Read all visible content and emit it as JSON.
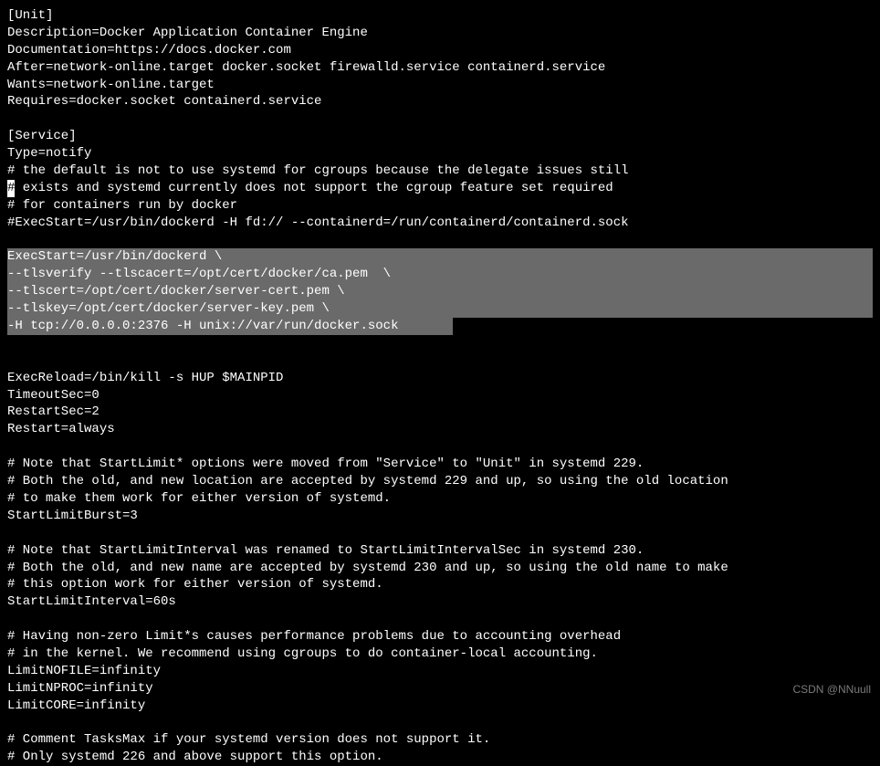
{
  "lines": {
    "l1": "[Unit]",
    "l2": "Description=Docker Application Container Engine",
    "l3": "Documentation=https://docs.docker.com",
    "l4": "After=network-online.target docker.socket firewalld.service containerd.service",
    "l5": "Wants=network-online.target",
    "l6": "Requires=docker.socket containerd.service",
    "l7": "",
    "l8": "[Service]",
    "l9": "Type=notify",
    "l10": "# the default is not to use systemd for cgroups because the delegate issues still",
    "l11a": "#",
    "l11b": " exists and systemd currently does not support the cgroup feature set required",
    "l12": "# for containers run by docker",
    "l13": "#ExecStart=/usr/bin/dockerd -H fd:// --containerd=/run/containerd/containerd.sock",
    "l14": "",
    "l15": "ExecStart=/usr/bin/dockerd \\",
    "l16": "--tlsverify --tlscacert=/opt/cert/docker/ca.pem  \\",
    "l17": "--tlscert=/opt/cert/docker/server-cert.pem \\",
    "l18": "--tlskey=/opt/cert/docker/server-key.pem \\",
    "l19": "-H tcp://0.0.0.0:2376 -H unix://var/run/docker.sock",
    "l20": "",
    "l21": "",
    "l22": "ExecReload=/bin/kill -s HUP $MAINPID",
    "l23": "TimeoutSec=0",
    "l24": "RestartSec=2",
    "l25": "Restart=always",
    "l26": "",
    "l27": "# Note that StartLimit* options were moved from \"Service\" to \"Unit\" in systemd 229.",
    "l28": "# Both the old, and new location are accepted by systemd 229 and up, so using the old location",
    "l29": "# to make them work for either version of systemd.",
    "l30": "StartLimitBurst=3",
    "l31": "",
    "l32": "# Note that StartLimitInterval was renamed to StartLimitIntervalSec in systemd 230.",
    "l33": "# Both the old, and new name are accepted by systemd 230 and up, so using the old name to make",
    "l34": "# this option work for either version of systemd.",
    "l35": "StartLimitInterval=60s",
    "l36": "",
    "l37": "# Having non-zero Limit*s causes performance problems due to accounting overhead",
    "l38": "# in the kernel. We recommend using cgroups to do container-local accounting.",
    "l39": "LimitNOFILE=infinity",
    "l40": "LimitNPROC=infinity",
    "l41": "LimitCORE=infinity",
    "l42": "",
    "l43": "# Comment TasksMax if your systemd version does not support it.",
    "l44": "# Only systemd 226 and above support this option."
  },
  "watermark": "CSDN @NNuull"
}
